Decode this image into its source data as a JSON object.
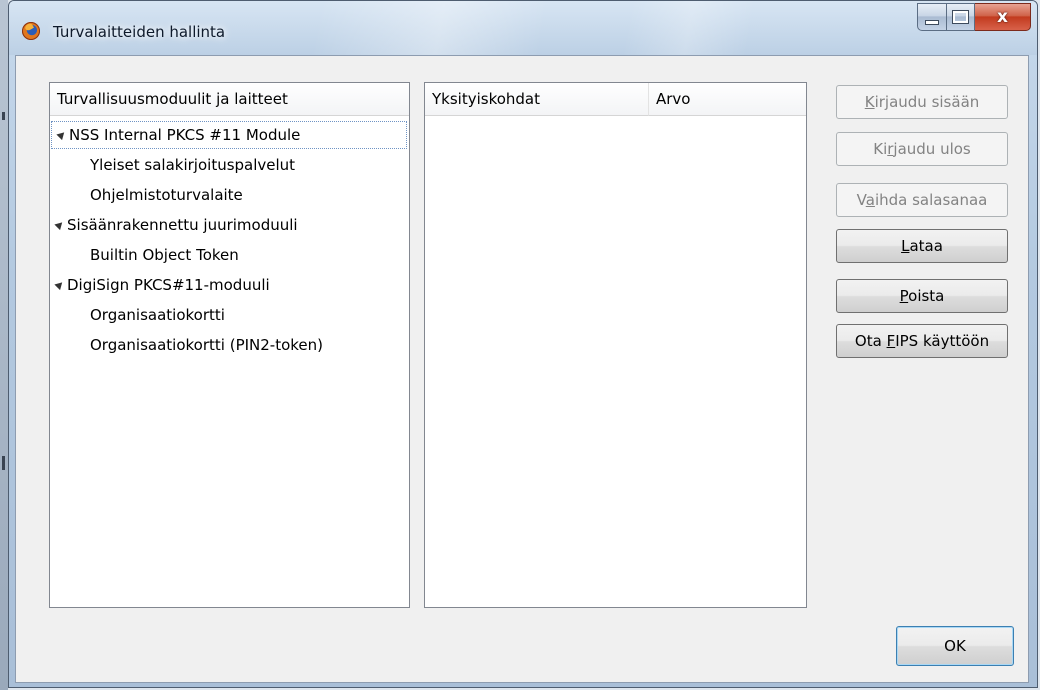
{
  "window": {
    "title": "Turvalaitteiden hallinta",
    "close_symbol": "x"
  },
  "tree": {
    "header": "Turvallisuusmoduulit ja laitteet",
    "rows": [
      {
        "label": "NSS Internal PKCS #11 Module",
        "level": 0,
        "expanded": true,
        "focused": true
      },
      {
        "label": "Yleiset salakirjoituspalvelut",
        "level": 1
      },
      {
        "label": "Ohjelmistoturvalaite",
        "level": 1
      },
      {
        "label": "Sisäänrakennettu juurimoduuli",
        "level": 0,
        "expanded": true
      },
      {
        "label": "Builtin Object Token",
        "level": 1
      },
      {
        "label": "DigiSign PKCS#11-moduuli",
        "level": 0,
        "expanded": true
      },
      {
        "label": "Organisaatiokortti",
        "level": 1
      },
      {
        "label": "Organisaatiokortti (PIN2-token)",
        "level": 1
      }
    ]
  },
  "details": {
    "col1": "Yksityiskohdat",
    "col2": "Arvo"
  },
  "buttons": {
    "login": {
      "pre": "",
      "key": "K",
      "post": "irjaudu sisään",
      "enabled": false
    },
    "logout": {
      "pre": "Ki",
      "key": "r",
      "post": "jaudu ulos",
      "enabled": false
    },
    "change_password": {
      "pre": "V",
      "key": "a",
      "post": "ihda salasanaa",
      "enabled": false
    },
    "load": {
      "pre": "",
      "key": "L",
      "post": "ataa",
      "enabled": true
    },
    "remove": {
      "pre": "",
      "key": "P",
      "post": "oista",
      "enabled": true
    },
    "fips": {
      "pre": "Ota ",
      "key": "F",
      "post": "IPS käyttöön",
      "enabled": true
    },
    "ok": "OK"
  },
  "icons": {
    "app": "firefox-icon",
    "minimize": "minimize-icon",
    "maximize": "maximize-icon",
    "close": "close-icon",
    "expand": "expanded-triangle-icon"
  }
}
